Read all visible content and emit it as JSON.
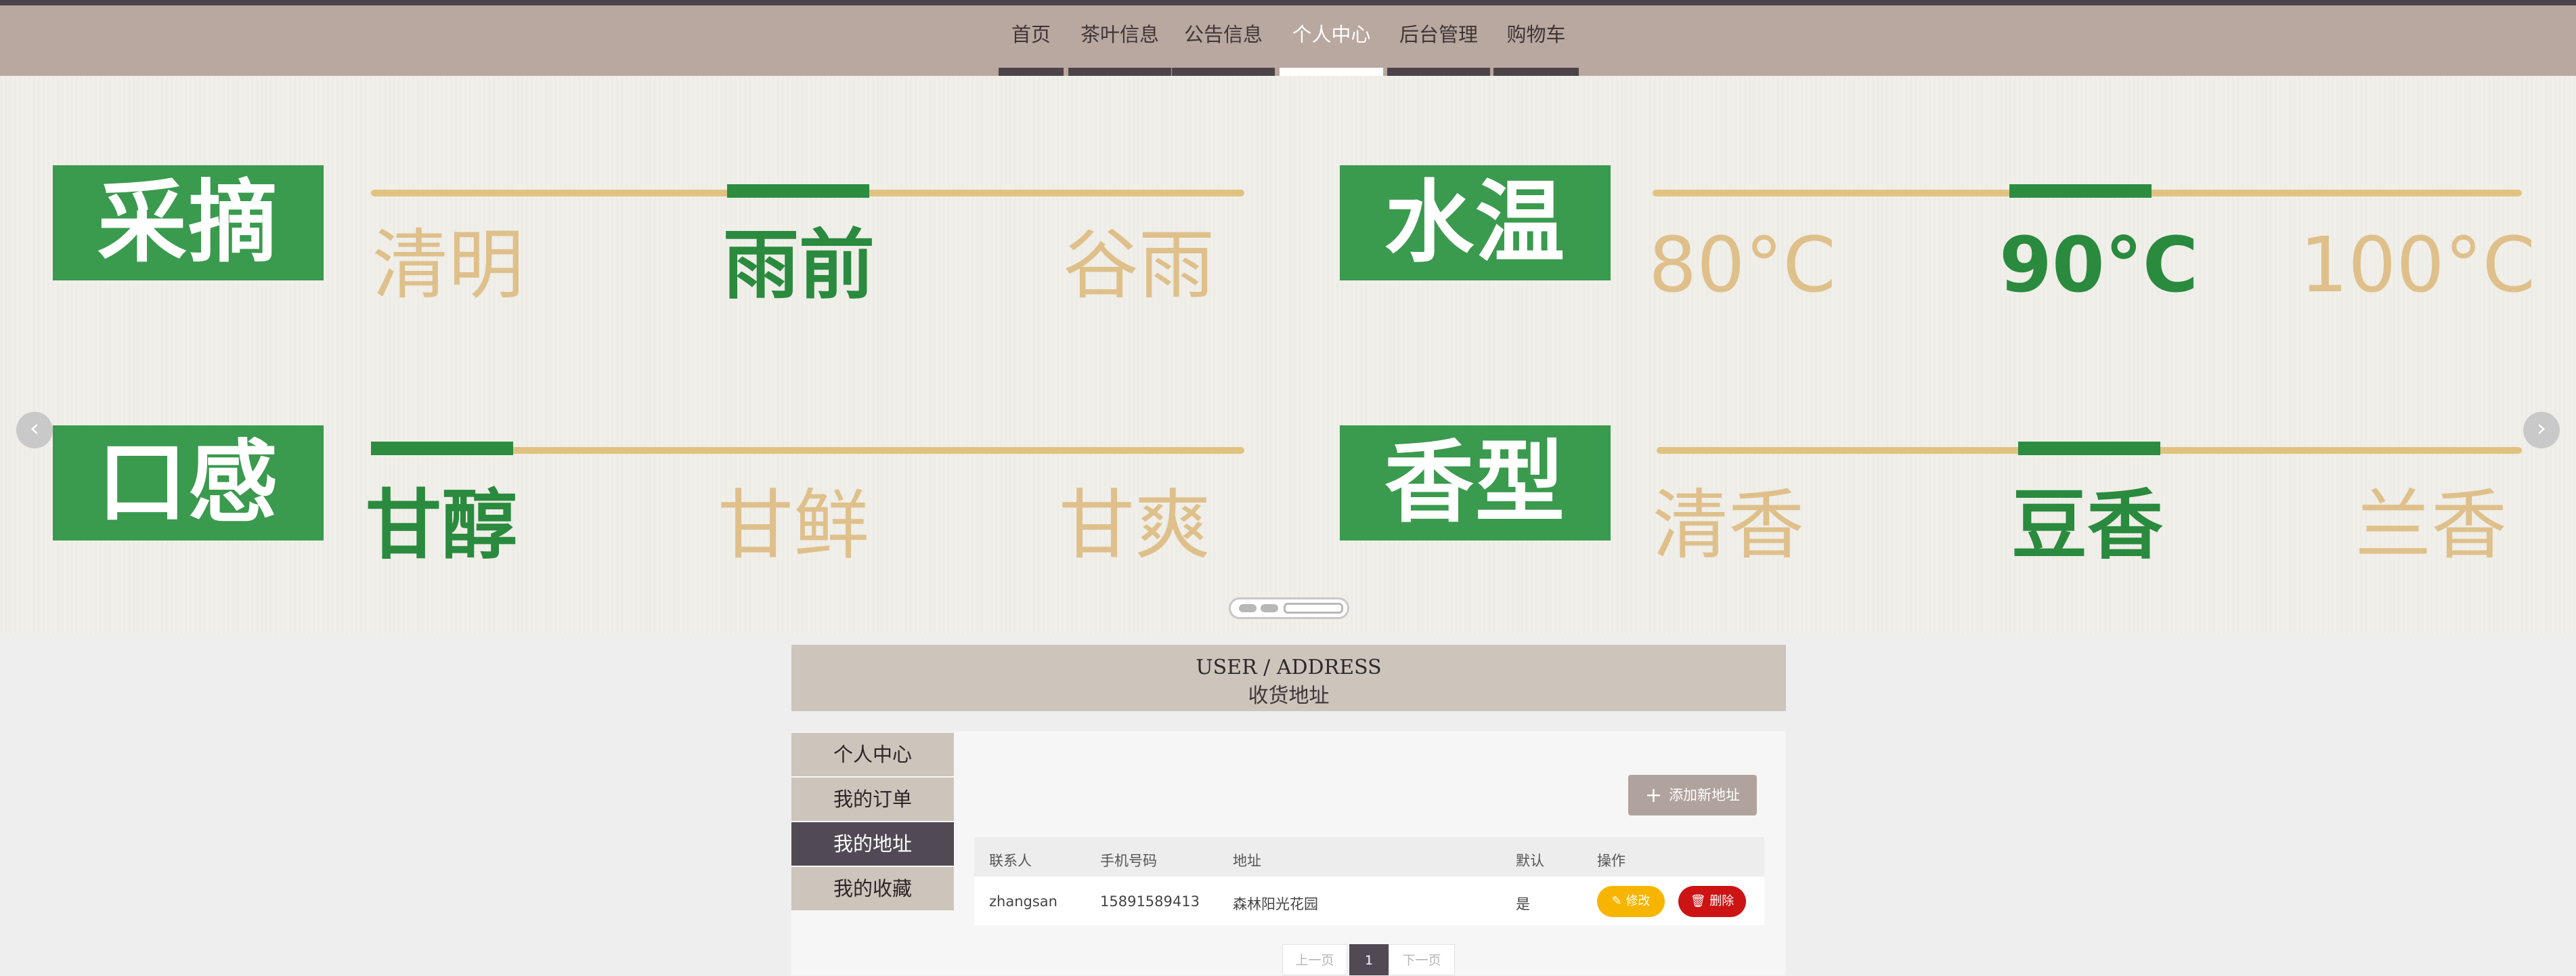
{
  "nav": {
    "items": [
      {
        "label": "首页",
        "active": false
      },
      {
        "label": "茶叶信息",
        "active": false
      },
      {
        "label": "公告信息",
        "active": false
      },
      {
        "label": "个人中心",
        "active": true
      },
      {
        "label": "后台管理",
        "active": false
      },
      {
        "label": "购物车",
        "active": false
      }
    ]
  },
  "banner": {
    "groups": [
      {
        "title": "采摘",
        "options": [
          "清明",
          "雨前",
          "谷雨"
        ],
        "selected": 1
      },
      {
        "title": "水温",
        "options": [
          "80°C",
          "90°C",
          "100°C"
        ],
        "selected": 1
      },
      {
        "title": "口感",
        "options": [
          "甘醇",
          "甘鲜",
          "甘爽"
        ],
        "selected": 0
      },
      {
        "title": "香型",
        "options": [
          "清香",
          "豆香",
          "兰香"
        ],
        "selected": 1
      }
    ],
    "prev_icon": "chevron-left-icon",
    "next_icon": "chevron-right-icon",
    "slide_count": 3,
    "active_slide": 2
  },
  "section": {
    "title_en": "USER / ADDRESS",
    "title_zh": "收货地址"
  },
  "sidebar": {
    "items": [
      {
        "label": "个人中心",
        "active": false
      },
      {
        "label": "我的订单",
        "active": false
      },
      {
        "label": "我的地址",
        "active": true
      },
      {
        "label": "我的收藏",
        "active": false
      }
    ]
  },
  "toolbar": {
    "add_label": "添加新地址",
    "add_icon": "plus-icon"
  },
  "table": {
    "headers": [
      "联系人",
      "手机号码",
      "地址",
      "默认",
      "操作"
    ],
    "rows": [
      {
        "contact": "zhangsan",
        "phone": "15891589413",
        "address": "森林阳光花园",
        "default": "是",
        "edit_label": "修改",
        "delete_label": "删除"
      }
    ]
  },
  "pagination": {
    "prev_label": "上一页",
    "current": "1",
    "next_label": "下一页"
  },
  "colors": {
    "nav_bg": "#b9a8a0",
    "accent_dark": "#514a54",
    "tag_green": "#3a9a4e",
    "option_gold": "#dfc08b",
    "edit_yellow": "#f7b500",
    "delete_red": "#cc1414"
  }
}
